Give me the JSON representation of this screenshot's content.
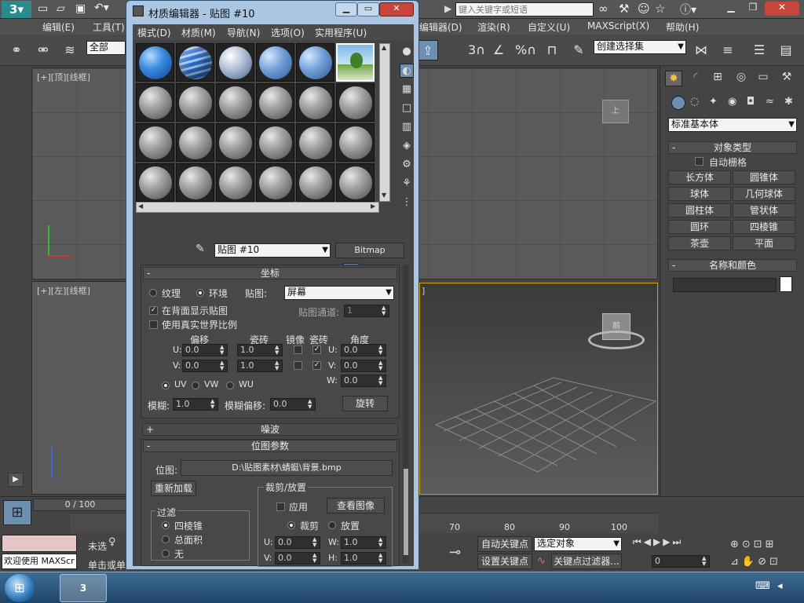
{
  "main": {
    "search_placeholder": "键入关键字或短语",
    "menu": [
      "编辑(E)",
      "工具(T)",
      "编辑器(D)",
      "渲染(R)",
      "自定义(U)",
      "MAXScript(X)",
      "帮助(H)"
    ],
    "selection_filter": "全部",
    "named_selection": "创建选择集",
    "toolbar_snap_labels": [
      "3",
      "%"
    ],
    "viewports": {
      "top_label": "[+][顶][线框]",
      "left_label": "[+][左][线框]",
      "persp_label": "]"
    },
    "viewcube_top": "上",
    "viewcube_persp": "前"
  },
  "command_panel": {
    "dropdown": "标准基本体",
    "object_type_header": "对象类型",
    "autogrid_label": "自动栅格",
    "buttons": [
      "长方体",
      "圆锥体",
      "球体",
      "几何球体",
      "圆柱体",
      "管状体",
      "圆环",
      "四棱锥",
      "茶壶",
      "平面"
    ],
    "name_color_header": "名称和颜色"
  },
  "bottom": {
    "timeline_frame": "0 / 100",
    "ruler_ticks": [
      "70",
      "80",
      "90",
      "100"
    ],
    "unselected_label": "未选",
    "welcome_text": "欢迎使用 MAXScr",
    "status_text": "单击或单",
    "auto_key": "自动关键点",
    "set_key": "设置关键点",
    "key_filter": "关键点过滤器...",
    "selected_object": "选定对象",
    "frame_field": "0"
  },
  "material_editor": {
    "title": "材质编辑器 - 贴图 #10",
    "menu": [
      "模式(D)",
      "材质(M)",
      "导航(N)",
      "选项(O)",
      "实用程序(U)"
    ],
    "map_name": "贴图 #10",
    "map_type": "Bitmap",
    "coords": {
      "header": "坐标",
      "texture": "纹理",
      "environ": "环境",
      "mapping_label": "贴图:",
      "mapping_value": "屏幕",
      "show_bg": "在背面显示贴图",
      "map_channel_label": "贴图通道:",
      "map_channel_value": "1",
      "real_world": "使用真实世界比例",
      "offset": "偏移",
      "tiling": "瓷砖",
      "mirror": "镜像",
      "tile": "瓷砖",
      "angle": "角度",
      "u_label": "U:",
      "v_label": "V:",
      "w_label": "W:",
      "offset_u": "0.0",
      "offset_v": "0.0",
      "tiling_u": "1.0",
      "tiling_v": "1.0",
      "angle_u": "0.0",
      "angle_v": "0.0",
      "angle_w": "0.0",
      "uv": "UV",
      "vw": "VW",
      "wu": "WU",
      "blur_label": "模糊:",
      "blur_value": "1.0",
      "blur_offset_label": "模糊偏移:",
      "blur_offset_value": "0.0",
      "rotate_button": "旋转"
    },
    "noise_header": "噪波",
    "bitmap_params": {
      "header": "位图参数",
      "bitmap_label": "位图:",
      "bitmap_path": "D:\\贴图素材\\蜻蜓\\背景.bmp",
      "reload": "重新加载",
      "crop_header": "裁剪/放置",
      "apply": "应用",
      "view_image": "查看图像",
      "crop": "裁剪",
      "place": "放置",
      "filter_header": "过滤",
      "pyramidal": "四棱锥",
      "summed_area": "总面积",
      "none": "无",
      "u_value": "0.0",
      "v_value": "0.0",
      "w_value": "1.0",
      "h_value": "1.0",
      "w_label": "W:",
      "h_label": "H:"
    }
  }
}
